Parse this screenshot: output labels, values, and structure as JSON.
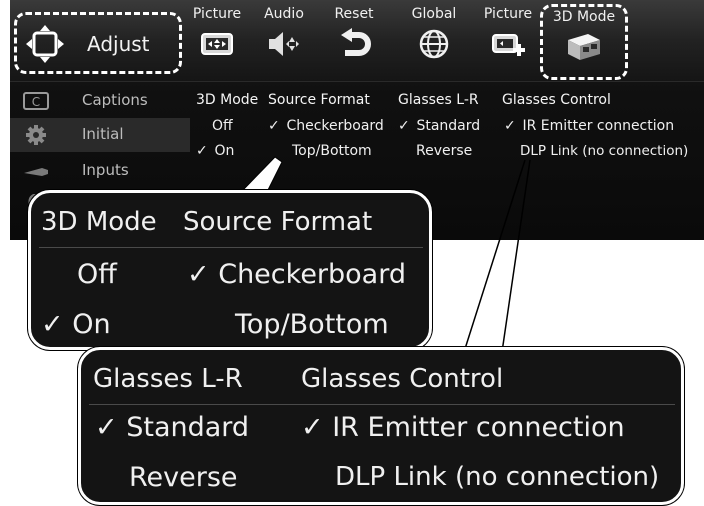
{
  "adjust": {
    "label": "Adjust"
  },
  "tools": [
    {
      "label": "Picture",
      "icon": "picture-icon"
    },
    {
      "label": "Audio",
      "icon": "audio-icon"
    },
    {
      "label": "Reset",
      "icon": "reset-icon"
    },
    {
      "label": "Global",
      "icon": "globe-icon"
    },
    {
      "label": "Picture",
      "icon": "picture-plus-icon"
    },
    {
      "label": "3D Mode",
      "icon": "3d-glasses-icon"
    }
  ],
  "sidebar": {
    "items": [
      {
        "label": "Captions",
        "icon": "captions-icon"
      },
      {
        "label": "Initial",
        "icon": "gear-icon"
      },
      {
        "label": "Inputs",
        "icon": "cable-icon"
      }
    ]
  },
  "columns": {
    "mode": {
      "header": "3D Mode",
      "options": [
        {
          "label": "Off",
          "checked": false
        },
        {
          "label": "On",
          "checked": true
        }
      ]
    },
    "source": {
      "header": "Source Format",
      "options": [
        {
          "label": "Checkerboard",
          "checked": true
        },
        {
          "label": "Top/Bottom",
          "checked": false
        }
      ]
    },
    "glasses": {
      "header": "Glasses L-R",
      "options": [
        {
          "label": "Standard",
          "checked": true
        },
        {
          "label": "Reverse",
          "checked": false
        }
      ]
    },
    "control": {
      "header": "Glasses Control",
      "options": [
        {
          "label": "IR Emitter connection",
          "checked": true
        },
        {
          "label": "DLP Link (no connection)",
          "checked": false
        }
      ]
    }
  },
  "checkmark": "✓",
  "colors": {
    "menu_bg": "#101010",
    "highlight_border": "#ffffff",
    "text": "#f0f0f0",
    "muted": "#bdbdbd"
  }
}
